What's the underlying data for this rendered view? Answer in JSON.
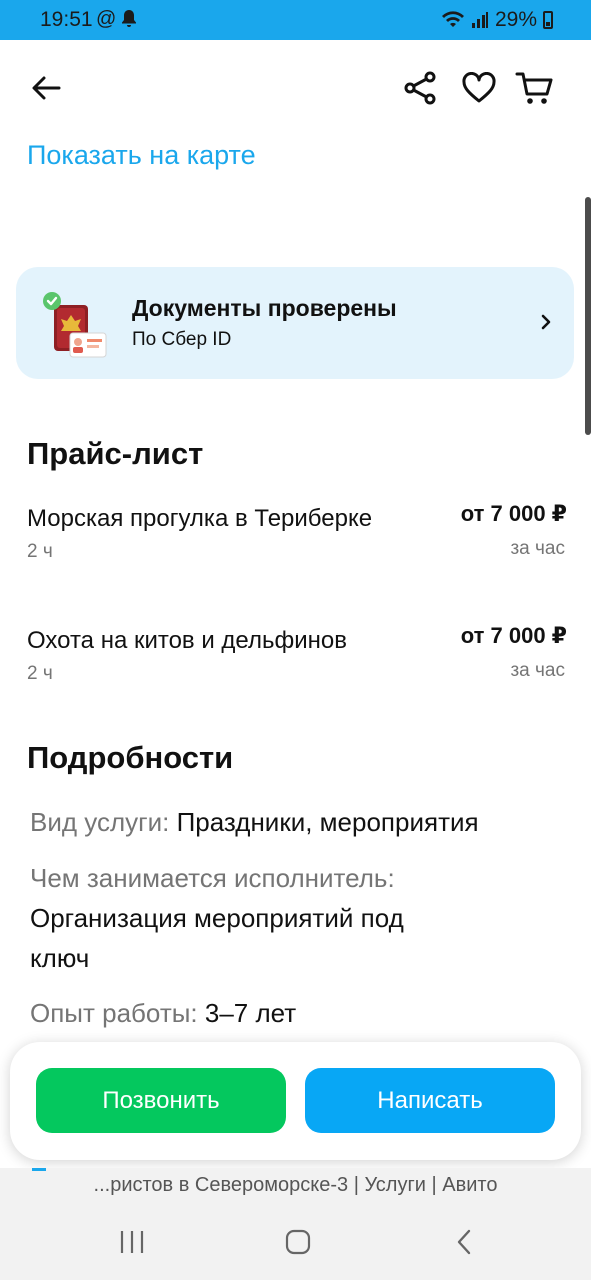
{
  "status_bar": {
    "time": "19:51",
    "battery": "29%"
  },
  "top_bar": {
    "back_icon": "arrow-left-icon",
    "share_icon": "share-icon",
    "favorite_icon": "heart-icon",
    "cart_icon": "cart-icon"
  },
  "map_link": "Показать на карте",
  "verification": {
    "title": "Документы проверены",
    "subtitle": "По Сбер ID"
  },
  "price_list": {
    "title": "Прайс-лист",
    "items": [
      {
        "name": "Морская прогулка в Териберке",
        "duration": "2 ч",
        "price": "от 7 000 ₽",
        "unit": "за час"
      },
      {
        "name": "Охота на китов и дельфинов",
        "duration": "2 ч",
        "price": "от 7 000 ₽",
        "unit": "за час"
      }
    ]
  },
  "details": {
    "title": "Подробности",
    "rows": [
      {
        "key": "Вид услуги:",
        "value": "Праздники, мероприятия"
      },
      {
        "key": "Чем занимается исполнитель:",
        "value": "Организация мероприятий под ключ"
      },
      {
        "key": "Опыт работы:",
        "value": "3–7 лет"
      }
    ]
  },
  "actions": {
    "call": "Позвонить",
    "write": "Написать"
  },
  "browser": {
    "url_text": "...ристов в Североморске-3 | Услуги | Авито"
  },
  "colors": {
    "accent": "#1aa7ec",
    "call_green": "#04c85e",
    "write_blue": "#08a7f5",
    "card_bg": "#e3f3fc"
  }
}
